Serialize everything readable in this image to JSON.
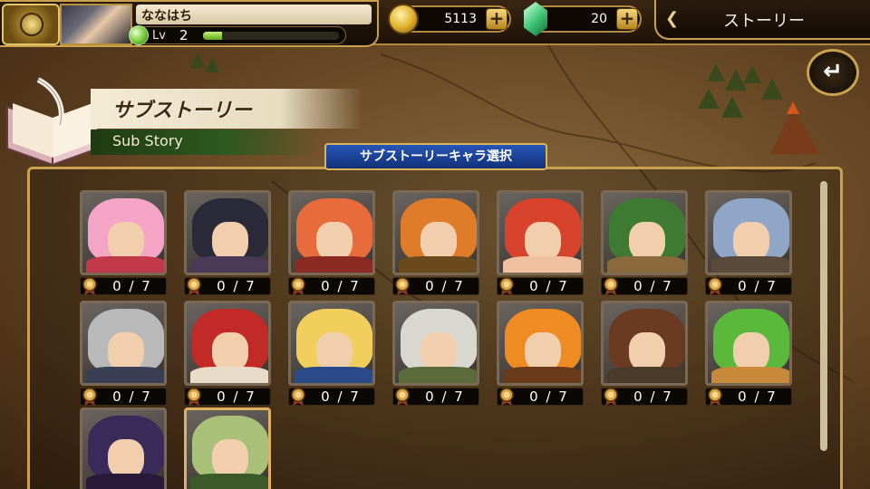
{
  "player": {
    "name": "ななはち",
    "level_label": "Lv",
    "level": "2",
    "exp_fraction": 0.14
  },
  "currency": {
    "coins": "5113",
    "gems": "20",
    "plus_label": "+"
  },
  "header": {
    "story_label": "ストーリー",
    "back_icon": "return-arrow-icon"
  },
  "section": {
    "title_jp": "サブストーリー",
    "title_en": "Sub Story",
    "select_label": "サブストーリーキャラ選択"
  },
  "characters": [
    {
      "count": "0 / 7",
      "hair": "#f4a4c4",
      "outfit": "#c23a4a"
    },
    {
      "count": "0 / 7",
      "hair": "#2a2a38",
      "outfit": "#4a3a58"
    },
    {
      "count": "0 / 7",
      "hair": "#e86b3c",
      "outfit": "#8a2a22"
    },
    {
      "count": "0 / 7",
      "hair": "#e07b2a",
      "outfit": "#6a4a1c"
    },
    {
      "count": "0 / 7",
      "hair": "#d8432e",
      "outfit": "#f0c0a0"
    },
    {
      "count": "0 / 7",
      "hair": "#3f7a32",
      "outfit": "#8a6a3a"
    },
    {
      "count": "0 / 7",
      "hair": "#8fa6c6",
      "outfit": "#5b4a3a"
    },
    {
      "count": "0 / 7",
      "hair": "#b9b9b9",
      "outfit": "#3a3f55"
    },
    {
      "count": "0 / 7",
      "hair": "#c22a28",
      "outfit": "#e8dcc8"
    },
    {
      "count": "0 / 7",
      "hair": "#f2cf5c",
      "outfit": "#2a4a8a"
    },
    {
      "count": "0 / 7",
      "hair": "#d8d8d0",
      "outfit": "#5a6a3a"
    },
    {
      "count": "0 / 7",
      "hair": "#f08a22",
      "outfit": "#6a3a1a"
    },
    {
      "count": "0 / 7",
      "hair": "#6a3a22",
      "outfit": "#4a3a28"
    },
    {
      "count": "0 / 7",
      "hair": "#5ab83a",
      "outfit": "#c88a3a"
    },
    {
      "count": "",
      "hair": "#3a2a5a",
      "outfit": "#2a1a3a"
    },
    {
      "count": "",
      "hair": "#a8c078",
      "outfit": "#3a5a2a"
    }
  ]
}
